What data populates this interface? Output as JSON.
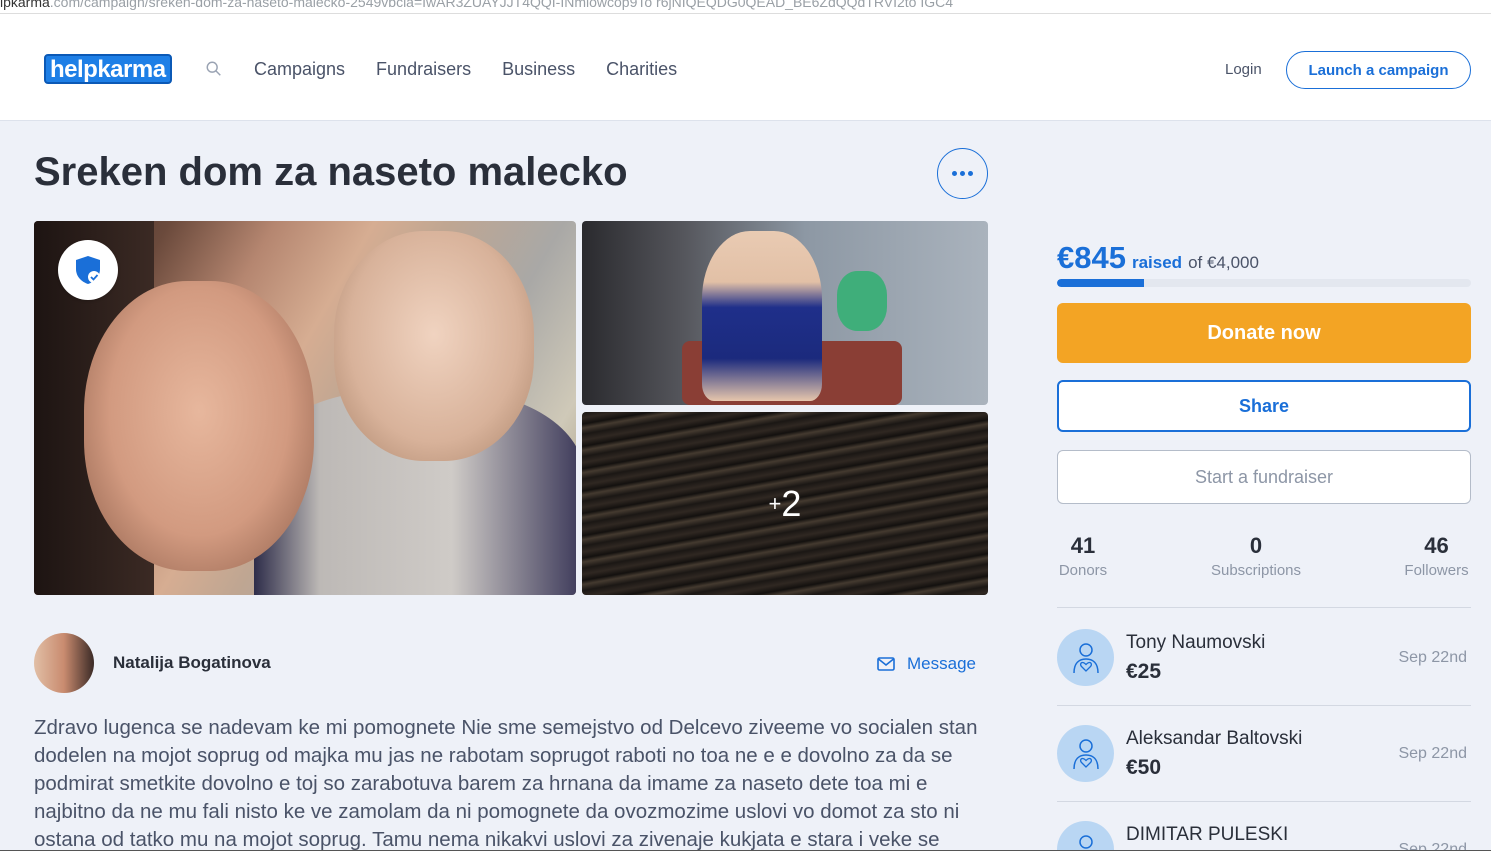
{
  "browser": {
    "url_prefix": "lpkarma",
    "url_rest": ".com/campaign/sreken-dom-za-naseto-malecko-2549vbcla=IwAR3ZUAYJJT4QQI-INmlowcop9To r6jNIQEQDG0QEAD_BE6ZdQQdTRVI2to IGC4"
  },
  "header": {
    "logo": "helpkarma",
    "nav": [
      "Campaigns",
      "Fundraisers",
      "Business",
      "Charities"
    ],
    "login": "Login",
    "launch": "Launch a campaign"
  },
  "campaign": {
    "title": "Sreken dom za naseto malecko",
    "more_photos": "2",
    "author": "Natalija Bogatinova",
    "message": "Message",
    "description": "Zdravo lugenca se nadevam ke mi pomognete  Nie sme semejstvo od Delcevo ziveeme vo socialen stan dodelen na mojot soprug od majka mu jas ne rabotam soprugot raboti no toa ne e e dovolno za da se podmirat smetkite dovolno e toj so zarabotuva barem za hrnana da imame za naseto dete toa mi e najbitno da ne  mu fali nisto  ke ve zamolam da ni pomognete da ovozmozime uslovi vo domot za sto ni ostana od tatko mu na mojot soprug. Tamu nema nikakvi uslovi za zivenaje kukjata e stara i veke se"
  },
  "funding": {
    "raised": "€845",
    "raised_label": "raised",
    "goal": "of €4,000",
    "progress_fraction": 0.21,
    "donate": "Donate now",
    "share": "Share",
    "start_fundraiser": "Start a fundraiser"
  },
  "stats": [
    {
      "value": "41",
      "label": "Donors"
    },
    {
      "value": "0",
      "label": "Subscriptions"
    },
    {
      "value": "46",
      "label": "Followers"
    }
  ],
  "donors": [
    {
      "name": "Tony Naumovski",
      "amount": "€25",
      "date": "Sep 22nd"
    },
    {
      "name": "Aleksandar Baltovski",
      "amount": "€50",
      "date": "Sep 22nd"
    },
    {
      "name": "DIMITAR PULESKI",
      "amount": "",
      "date": "Sep 22nd"
    }
  ],
  "colors": {
    "brand_blue": "#1a6fd8",
    "donate_orange": "#f3a424",
    "page_bg": "#eef1f8"
  }
}
